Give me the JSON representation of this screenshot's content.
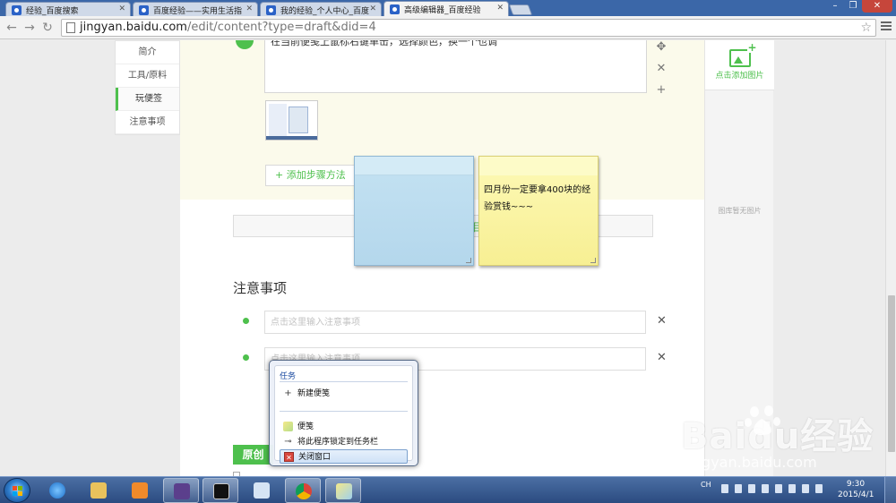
{
  "browser": {
    "tabs": [
      {
        "label": "经验_百度搜索",
        "active": false
      },
      {
        "label": "百度经验——实用生活指",
        "active": false
      },
      {
        "label": "我的经验_个人中心_百度",
        "active": false
      },
      {
        "label": "高级编辑器_百度经验",
        "active": true
      }
    ],
    "url_host": "jingyan.baidu.com",
    "url_rest": "/edit/content?type=draft&did=4"
  },
  "left_nav": {
    "items": [
      "简介",
      "工具/原料",
      "玩便签",
      "注意事项"
    ],
    "current_index": 2
  },
  "editor": {
    "step_text": "在当前便笺上鼠标右键单击，选择颜色，换一个也调",
    "add_step_label": "添加步骤方法",
    "notes_title": "注意事项",
    "note_placeholder": "点击这里输入注意事项",
    "original_label": "原创"
  },
  "right_panel": {
    "add_image_label": "点击添加图片",
    "empty_label": "图库暂无图片"
  },
  "sticky_notes": {
    "yellow_text": "四月份一定要拿400块的经验赏钱~~~"
  },
  "jump_list": {
    "header": "任务",
    "new_note": "新建便笺",
    "app_name": "便笺",
    "pin": "将此程序锁定到任务栏",
    "close": "关闭窗口"
  },
  "taskbar": {
    "lang": "CH",
    "time": "9:30",
    "date": "2015/4/1"
  },
  "watermark": {
    "brand": "Baidu经验",
    "url": "jingyan.baidu.com"
  },
  "colors": {
    "accent_green": "#4ec04d",
    "tab_strip": "#3b67a8",
    "sticky_yellow": "#f7ef93",
    "sticky_blue": "#b4d7ec"
  }
}
